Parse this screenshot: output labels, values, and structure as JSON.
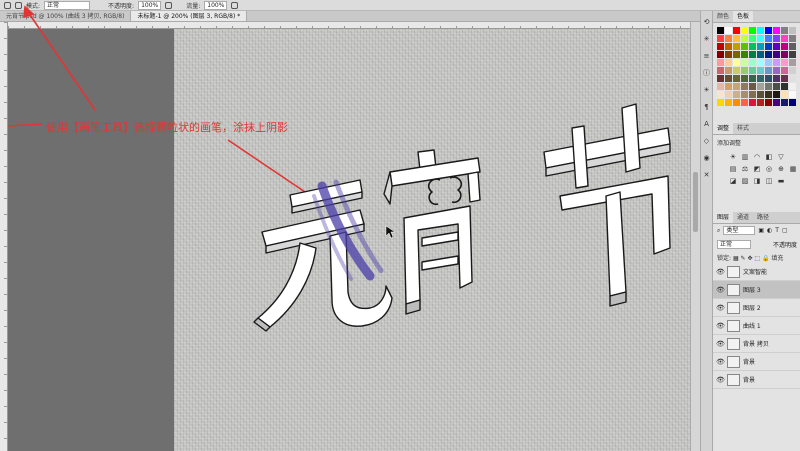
{
  "options_bar": {
    "mode_label": "模式:",
    "mode_value": "正常",
    "opacity_label": "不透明度:",
    "opacity_value": "100%",
    "flow_label": "流量:",
    "flow_value": "100%"
  },
  "tabs": [
    {
      "label": "元宵节.psd @ 100% (曲线 3 拷贝, RGB/8)"
    },
    {
      "label": "未标题-1 @ 200% (图层 3, RGB/8) *"
    }
  ],
  "annotation": {
    "text": "使用【画笔工具】选择颗粒状的画笔，涂抹上阴影",
    "color": "#e33434"
  },
  "canvas": {
    "title_text": "元宵节",
    "stroke_color": "#4a3fa8"
  },
  "right_panel": {
    "tabs": [
      "颜色",
      "色板"
    ],
    "adjust_tabs": [
      "调整",
      "样式"
    ],
    "adjust_title": "添加调整",
    "layer_tabs": [
      "图层",
      "通道",
      "路径"
    ],
    "filter_label": "类型",
    "blend_mode": "正常",
    "opacity_label": "不透明度",
    "lock_label": "锁定:",
    "fill_label": "填充",
    "layers": [
      {
        "name": "文案智能",
        "selected": false
      },
      {
        "name": "图层 3",
        "selected": true
      },
      {
        "name": "图层 2",
        "selected": false
      },
      {
        "name": "曲线 1",
        "selected": false
      },
      {
        "name": "背景 拷贝",
        "selected": false
      },
      {
        "name": "背景",
        "selected": false
      },
      {
        "name": "背景",
        "selected": false
      }
    ]
  },
  "swatch_colors": [
    "#000000",
    "#ffffff",
    "#ff0000",
    "#ffff00",
    "#00ff00",
    "#00ffff",
    "#0000ff",
    "#ff00ff",
    "#808080",
    "#c0c0c0",
    "#ff4040",
    "#ff8040",
    "#ffbf40",
    "#bfff40",
    "#40ff80",
    "#40ffff",
    "#4080ff",
    "#8040ff",
    "#ff40bf",
    "#7f7f7f",
    "#c00000",
    "#c06000",
    "#c0a000",
    "#60c000",
    "#00c060",
    "#00a0c0",
    "#0040c0",
    "#6000c0",
    "#c00080",
    "#606060",
    "#800000",
    "#804000",
    "#806000",
    "#408000",
    "#008040",
    "#006080",
    "#002080",
    "#400080",
    "#800060",
    "#404040",
    "#ff9999",
    "#ffcc99",
    "#ffff99",
    "#ccff99",
    "#99ffcc",
    "#99ffff",
    "#99ccff",
    "#cc99ff",
    "#ff99cc",
    "#a0a0a0",
    "#cc6666",
    "#cc9966",
    "#cccc66",
    "#99cc66",
    "#66cc99",
    "#66cccc",
    "#6699cc",
    "#9966cc",
    "#cc6699",
    "#d0d0d0",
    "#663333",
    "#664d33",
    "#666633",
    "#4d6633",
    "#33664d",
    "#336666",
    "#334d66",
    "#4d3366",
    "#66334d",
    "#e0e0e0",
    "#e6b8a2",
    "#d9a066",
    "#c7a770",
    "#8f7a5e",
    "#6b5a45",
    "#a3a39b",
    "#74786d",
    "#4b5047",
    "#2f332d",
    "#f0f0f0",
    "#f5e6cc",
    "#e8d4b0",
    "#c9b18a",
    "#a68f6a",
    "#80704f",
    "#5c5038",
    "#3b3322",
    "#1e1a11",
    "#ffe0b0",
    "#fafafa",
    "#ffd700",
    "#ffb300",
    "#ff8c00",
    "#ff6347",
    "#dc143c",
    "#b22222",
    "#8b0000",
    "#4b0082",
    "#191970",
    "#000080"
  ]
}
